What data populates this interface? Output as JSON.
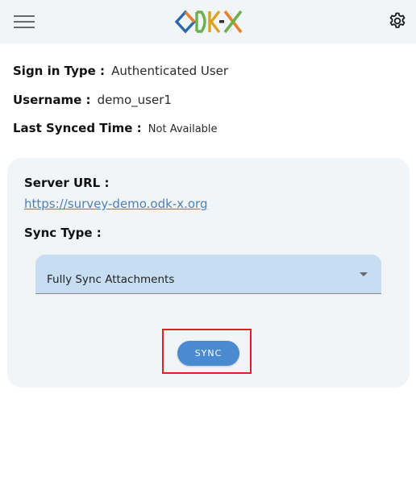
{
  "header": {
    "menu_icon": "hamburger-menu-icon",
    "logo": {
      "text": "ODK-X",
      "colors": {
        "blue": "#2f67a8",
        "orange": "#e8822a",
        "green": "#6ab04c",
        "gold": "#d9a51e",
        "dark": "#333333"
      }
    },
    "settings_icon": "gear-icon"
  },
  "info": {
    "sign_in_type_label": "Sign in Type :",
    "sign_in_type_value": "Authenticated User",
    "username_label": "Username :",
    "username_value": "demo_user1",
    "last_synced_label": "Last Synced Time :",
    "last_synced_value": "Not Available"
  },
  "sync_card": {
    "server_url_label": "Server URL :",
    "server_url": "https://survey-demo.odk-x.org",
    "sync_type_label": "Sync Type :",
    "sync_type_selected": "Fully Sync Attachments",
    "sync_button_label": "SYNC"
  },
  "colors": {
    "accent": "#4a8ad0",
    "link": "#4a82b8",
    "select_bg": "#c7ddf2",
    "card_bg": "#f2f5f8",
    "highlight": "#e0201f"
  }
}
